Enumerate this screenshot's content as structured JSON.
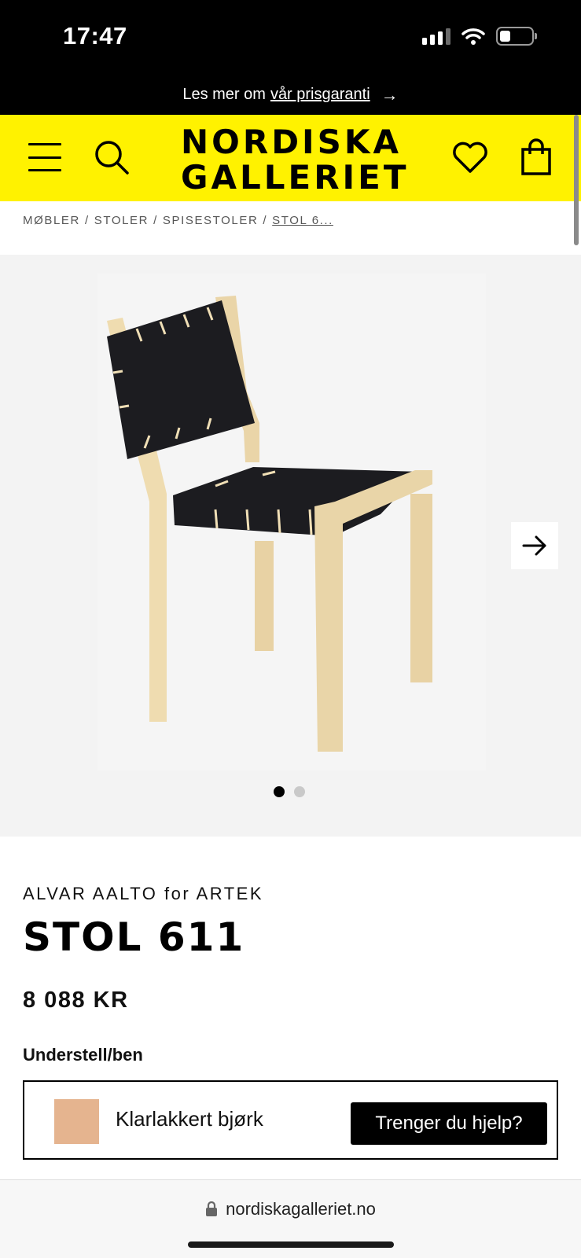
{
  "status_bar": {
    "time": "17:47",
    "battery_level": 0.3,
    "icons": [
      "signal-icon",
      "wifi-icon",
      "battery-icon"
    ]
  },
  "promo": {
    "prefix": "Les mer om",
    "link": "vår prisgaranti",
    "arrow": "→"
  },
  "header": {
    "logo_line1": "NORDISKA",
    "logo_line2": "GALLERIET",
    "icons": [
      "menu-icon",
      "search-icon",
      "heart-icon",
      "shopping-bag-icon"
    ],
    "background_color": "#fff200"
  },
  "breadcrumb": {
    "items": [
      "MØBLER",
      "STOLER",
      "SPISESTOLER"
    ],
    "separator": "/",
    "current": "STOL 6..."
  },
  "gallery": {
    "image_count": 2,
    "active_index": 0,
    "next_icon": "arrow-right-icon"
  },
  "product": {
    "brand": "ALVAR AALTO for ARTEK",
    "title": "STOL 611",
    "price": "8 088 KR",
    "option_label": "Understell/ben",
    "option_value": "Klarlakkert bjørk",
    "swatch_color": "#e5b48f"
  },
  "help": {
    "label": "Trenger du hjelp?"
  },
  "browser": {
    "url": "nordiskagalleriet.no",
    "lock_icon": "lock-icon"
  }
}
